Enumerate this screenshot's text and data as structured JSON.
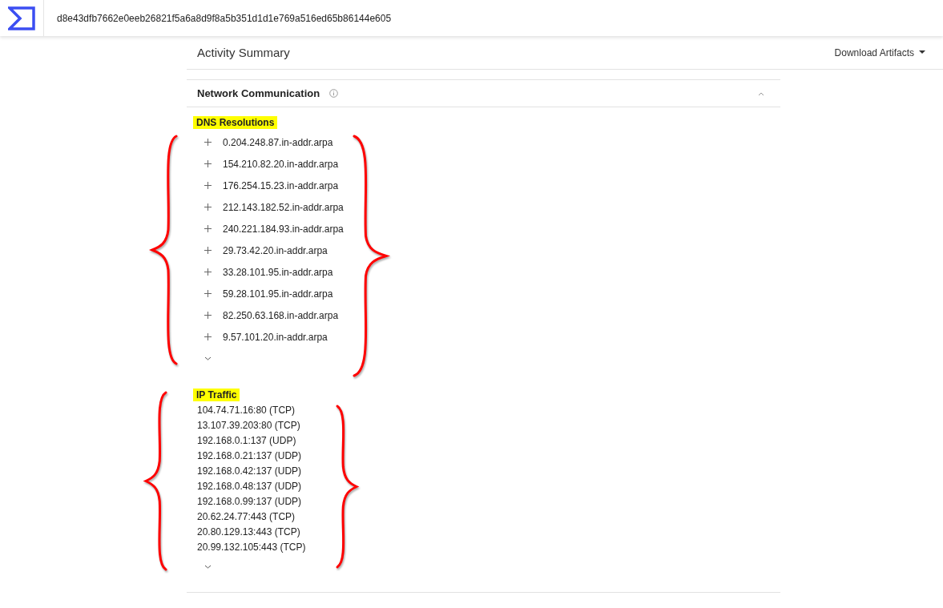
{
  "header": {
    "hash": "d8e43dfb7662e0eeb26821f5a6a8d9f8a5b351d1d1e769a516ed65b86144e605"
  },
  "summary": {
    "title": "Activity Summary",
    "download": "Download Artifacts"
  },
  "section": {
    "title": "Network Communication",
    "expanded": true
  },
  "dns": {
    "title": "DNS Resolutions",
    "highlighted": true,
    "items": [
      "0.204.248.87.in-addr.arpa",
      "154.210.82.20.in-addr.arpa",
      "176.254.15.23.in-addr.arpa",
      "212.143.182.52.in-addr.arpa",
      "240.221.184.93.in-addr.arpa",
      "29.73.42.20.in-addr.arpa",
      "33.28.101.95.in-addr.arpa",
      "59.28.101.95.in-addr.arpa",
      "82.250.63.168.in-addr.arpa",
      "9.57.101.20.in-addr.arpa"
    ]
  },
  "ip": {
    "title": "IP Traffic",
    "highlighted": true,
    "items": [
      "104.74.71.16:80 (TCP)",
      "13.107.39.203:80 (TCP)",
      "192.168.0.1:137 (UDP)",
      "192.168.0.21:137 (UDP)",
      "192.168.0.42:137 (UDP)",
      "192.168.0.48:137 (UDP)",
      "192.168.0.99:137 (UDP)",
      "20.62.24.77:443 (TCP)",
      "20.80.129.13:443 (TCP)",
      "20.99.132.105:443 (TCP)"
    ]
  }
}
